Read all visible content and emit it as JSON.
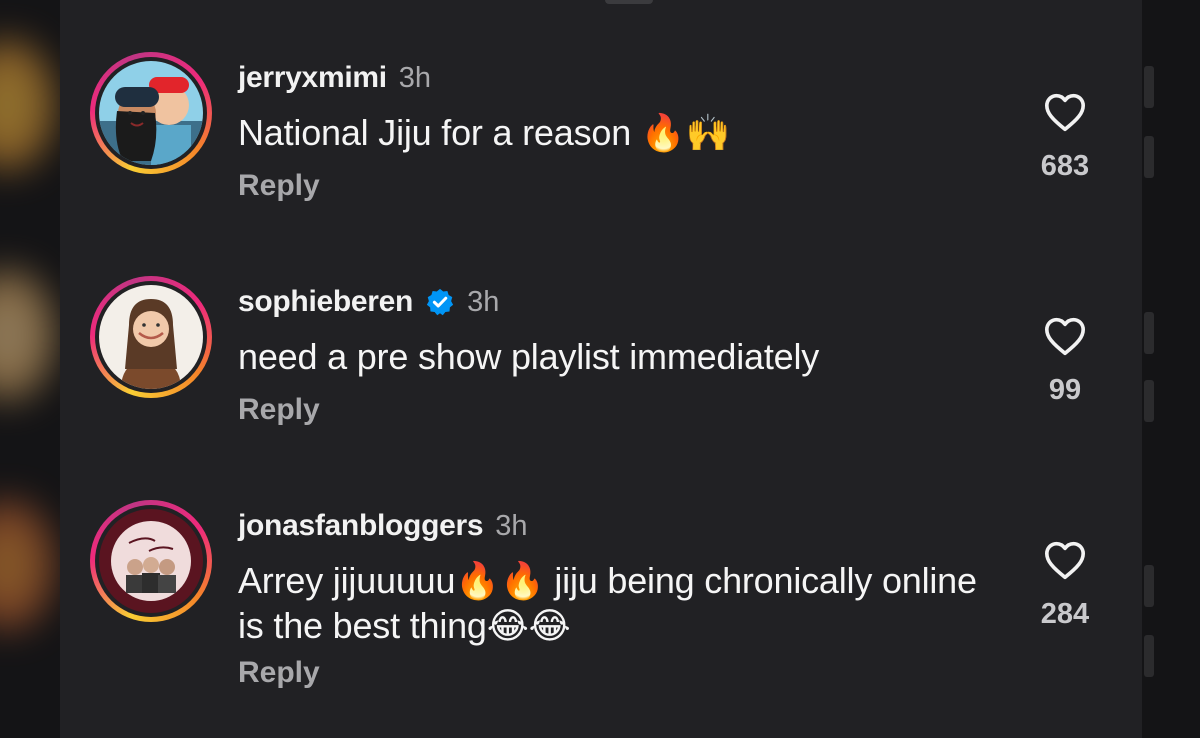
{
  "comments": [
    {
      "username": "jerryxmimi",
      "verified": false,
      "time": "3h",
      "text": "National Jiju for a reason 🔥🙌",
      "reply_label": "Reply",
      "likes": "683",
      "avatar_icon": "couple-photo-avatar"
    },
    {
      "username": "sophieberen",
      "verified": true,
      "time": "3h",
      "text": "need a pre show playlist immediately",
      "reply_label": "Reply",
      "likes": "99",
      "avatar_icon": "woman-photo-avatar"
    },
    {
      "username": "jonasfanbloggers",
      "verified": false,
      "time": "3h",
      "text": "Arrey jijuuuuu🔥🔥 jiju being chronically online is the best thing😂😂",
      "reply_label": "Reply",
      "likes": "284",
      "avatar_icon": "fan-group-logo-avatar"
    }
  ],
  "colors": {
    "background": "#212124",
    "username": "#f2f2f2",
    "secondary": "#a8a8ab",
    "verified_blue": "#0095f6"
  }
}
